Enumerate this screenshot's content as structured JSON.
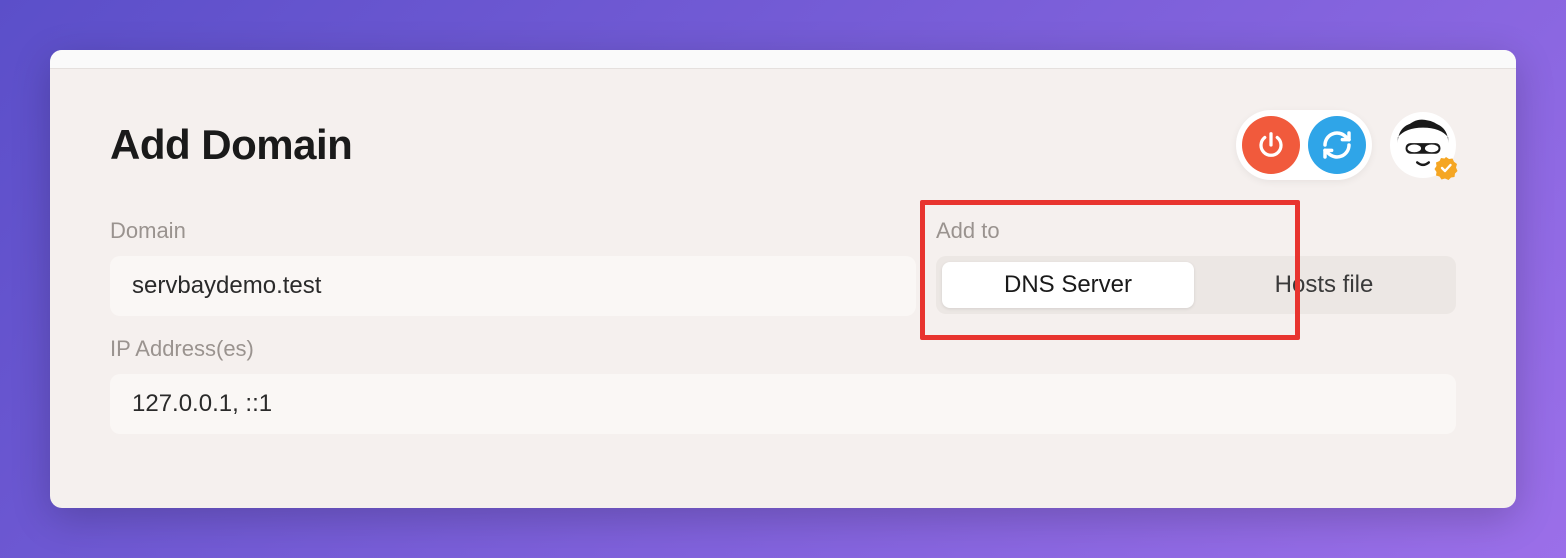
{
  "title": "Add Domain",
  "labels": {
    "domain": "Domain",
    "addto": "Add to",
    "ip": "IP Address(es)"
  },
  "fields": {
    "domain_value": "servbaydemo.test",
    "ip_value": "127.0.0.1, ::1"
  },
  "segmented": {
    "option_a": "DNS Server",
    "option_b": "Hosts file"
  }
}
